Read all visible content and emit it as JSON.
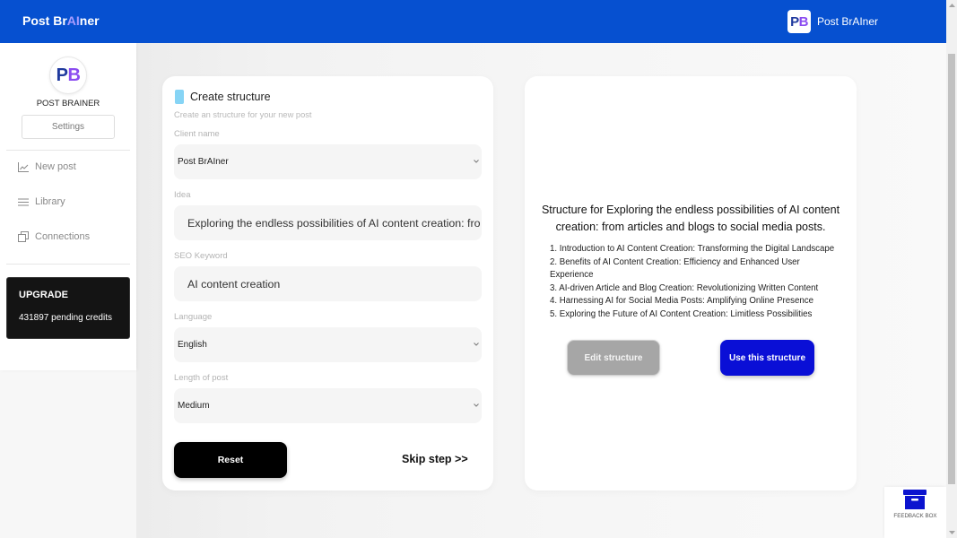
{
  "header": {
    "brand": {
      "part_1": "Post Br",
      "highlight": "AI",
      "part_2": "ner"
    },
    "account": {
      "logo_letter_1": "P",
      "logo_letter_2": "B",
      "name": "Post BrAIner"
    }
  },
  "sidebar": {
    "avatar": {
      "letter_1": "P",
      "letter_2": "B"
    },
    "profile_name": "POST BRAINER",
    "settings_label": "Settings",
    "nav": [
      {
        "label": "New post",
        "icon": "line-chart-icon"
      },
      {
        "label": "Library",
        "icon": "list-icon"
      },
      {
        "label": "Connections",
        "icon": "copy-icon"
      }
    ],
    "upgrade": {
      "title": "UPGRADE",
      "credits": "431897 pending credits"
    }
  },
  "create_form": {
    "title": "Create structure",
    "subtitle": "Create an structure for your new post",
    "fields": {
      "client_name": {
        "label": "Client name",
        "value": "Post BrAIner"
      },
      "idea": {
        "label": "Idea",
        "value": "Exploring the endless possibilities of AI content creation: fro"
      },
      "seo_keyword": {
        "label": "SEO Keyword",
        "value": "AI content creation"
      },
      "language": {
        "label": "Language",
        "value": "English"
      },
      "length": {
        "label": "Length of post",
        "value": "Medium"
      }
    },
    "reset_label": "Reset",
    "skip_label": "Skip step >>"
  },
  "structure_preview": {
    "heading": "Structure for Exploring the endless possibilities of AI content creation: from articles and blogs to social media posts.",
    "items": [
      "1. Introduction to AI Content Creation: Transforming the Digital Landscape",
      "2. Benefits of AI Content Creation: Efficiency and Enhanced User Experience",
      "3. AI-driven Article and Blog Creation: Revolutionizing Written Content",
      "4. Harnessing AI for Social Media Posts: Amplifying Online Presence",
      "5. Exploring the Future of AI Content Creation: Limitless Possibilities"
    ],
    "edit_label": "Edit structure",
    "use_label": "Use this structure"
  },
  "feedback": {
    "label": "FEEDBACK BOX",
    "icon": "box-icon"
  },
  "colors": {
    "header_bg": "#0650d0",
    "brand_highlight": "#a89cff",
    "logo_p": "#1f3a9e",
    "logo_b": "#8b4cf0",
    "accent_block": "#86d4f5",
    "primary_button": "#0a0fd6",
    "secondary_button": "#a6a6a6",
    "reset_button": "#000000",
    "upgrade_bg": "#141414",
    "feedback_icon": "#0b13cf"
  }
}
